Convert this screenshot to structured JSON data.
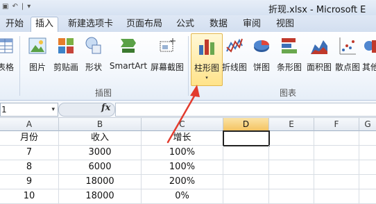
{
  "title": {
    "text": "折现.xlsx - Microsoft E"
  },
  "qat": {
    "save": "▣",
    "undo": "↶",
    "sep": "|",
    "dropdown": "▾"
  },
  "tabs": [
    "开始",
    "插入",
    "新建选项卡",
    "页面布局",
    "公式",
    "数据",
    "审阅",
    "视图"
  ],
  "ribbon": {
    "buttons": [
      {
        "label": "表格"
      },
      {
        "label": "图片"
      },
      {
        "label": "剪贴画"
      },
      {
        "label": "形状"
      },
      {
        "label": "SmartArt"
      },
      {
        "label": "屏幕截图"
      },
      {
        "label": "柱形图"
      },
      {
        "label": "折线图"
      },
      {
        "label": "饼图"
      },
      {
        "label": "条形图"
      },
      {
        "label": "面积图"
      },
      {
        "label": "散点图"
      },
      {
        "label": "其他"
      }
    ],
    "groups": {
      "illustrations": "插图",
      "charts": "图表"
    },
    "dropdown_arrow": "▾"
  },
  "formula_bar": {
    "name_box": "1",
    "name_dropdown": "▾",
    "fx": "fx",
    "value": ""
  },
  "sheet": {
    "columns": [
      "A",
      "B",
      "C",
      "D",
      "E",
      "F",
      "G"
    ],
    "selected_column": "D",
    "rows": [
      [
        "月份",
        "收入",
        "增长"
      ],
      [
        "7",
        "3000",
        "100%"
      ],
      [
        "8",
        "6000",
        "100%"
      ],
      [
        "9",
        "18000",
        "200%"
      ],
      [
        "10",
        "18000",
        "0%"
      ]
    ]
  },
  "colors": {
    "annotation_arrow": "#e23b2e",
    "highlight": "#ffe38a"
  }
}
